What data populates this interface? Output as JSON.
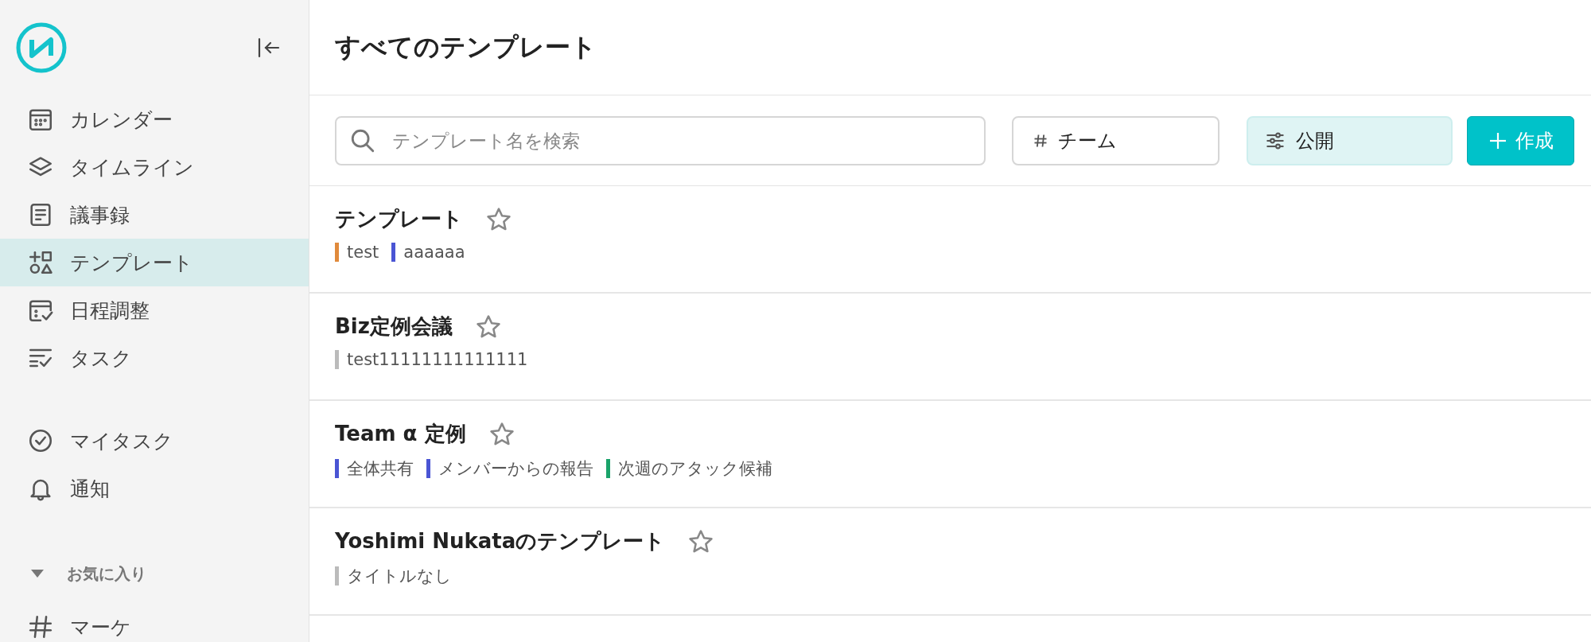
{
  "sidebar": {
    "nav": [
      {
        "label": "カレンダー",
        "selected": false
      },
      {
        "label": "タイムライン",
        "selected": false
      },
      {
        "label": "議事録",
        "selected": false
      },
      {
        "label": "テンプレート",
        "selected": true
      },
      {
        "label": "日程調整",
        "selected": false
      },
      {
        "label": "タスク",
        "selected": false
      }
    ],
    "personal": [
      {
        "label": "マイタスク"
      },
      {
        "label": "通知"
      }
    ],
    "favorites": {
      "title": "お気に入り",
      "expanded": true,
      "items": [
        {
          "label": "マーケ"
        }
      ]
    }
  },
  "page_title": "すべてのテンプレート",
  "toolbar": {
    "search": {
      "placeholder": "テンプレート名を検索"
    },
    "team_filter": "チーム",
    "visibility_filter": "公開",
    "create_button": "作成"
  },
  "templates": [
    {
      "title": "テンプレート",
      "starred": false,
      "tags": [
        {
          "label": "test",
          "color": "#e08a3c"
        },
        {
          "label": "aaaaaa",
          "color": "#4a55d4"
        }
      ]
    },
    {
      "title": "Biz定例会議",
      "starred": false,
      "tags": [
        {
          "label": "test11111111111111",
          "color": "#bbbbbb"
        }
      ]
    },
    {
      "title": "Team α 定例",
      "starred": false,
      "tags": [
        {
          "label": "全体共有",
          "color": "#4a55d4"
        },
        {
          "label": "メンバーからの報告",
          "color": "#4a55d4"
        },
        {
          "label": "次週のアタック候補",
          "color": "#1aa36a"
        }
      ]
    },
    {
      "title": "Yoshimi Nukataのテンプレート",
      "starred": false,
      "tags": [
        {
          "label": "タイトルなし",
          "color": "#bbbbbb"
        }
      ]
    }
  ]
}
